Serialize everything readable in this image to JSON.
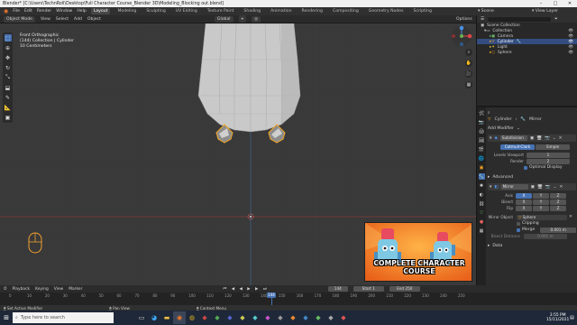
{
  "window": {
    "title": "Blender* [C:\\Users\\TechnRoll\\Desktop\\Full Character Course_Blender 3D\\Modeling_Blocking out.blend]"
  },
  "menus": [
    "File",
    "Edit",
    "Render",
    "Window",
    "Help"
  ],
  "workspaces": [
    "Layout",
    "Modeling",
    "Sculpting",
    "UV Editing",
    "Texture Paint",
    "Shading",
    "Animation",
    "Rendering",
    "Compositing",
    "Geometry Nodes",
    "Scripting"
  ],
  "top_right": {
    "scene": "Scene",
    "view_layer": "View Layer"
  },
  "viewport_header": {
    "mode": "Object Mode",
    "menus": [
      "View",
      "Select",
      "Add",
      "Object"
    ],
    "orientation": "Global",
    "options": "Options"
  },
  "view_info": {
    "line1": "Front Orthographic",
    "line2": "(144) Collection | Cylinder",
    "line3": "10 Centimeters"
  },
  "outliner": {
    "root": "Scene Collection",
    "items": [
      {
        "label": "Collection",
        "selected": false
      },
      {
        "label": "Camera",
        "selected": false
      },
      {
        "label": "Cylinder",
        "selected": true
      },
      {
        "label": "Light",
        "selected": false
      },
      {
        "label": "Sphere",
        "selected": false
      }
    ]
  },
  "properties": {
    "object": "Cylinder",
    "modifier_tab": "Mirror",
    "add_modifier": "Add Modifier",
    "subdivision": {
      "name": "Subdivision",
      "tab_active": "Catmull-Clark",
      "tab_other": "Simple",
      "levels_viewport_label": "Levels Viewport",
      "levels_viewport": "1",
      "render_label": "Render",
      "render": "2",
      "optimal_display": "Optimal Display",
      "advanced": "Advanced"
    },
    "mirror": {
      "name": "Mirror",
      "axis_label": "Axis",
      "bisect_label": "Bisect",
      "flip_label": "Flip",
      "axes": [
        "X",
        "Y",
        "Z"
      ],
      "mirror_object_label": "Mirror Object",
      "mirror_object": "Sphere",
      "clipping": "Clipping",
      "merge": "Merge",
      "merge_value": "0.001 m",
      "bisect_distance_label": "Bisect Distance",
      "bisect_distance": "0.001 m",
      "data": "Data"
    }
  },
  "timeline": {
    "menus": [
      "Playback",
      "Keying",
      "View",
      "Marker"
    ],
    "current_frame": "144",
    "start_label": "Start",
    "start": "1",
    "end_label": "End",
    "end": "250",
    "ticks": [
      "0",
      "10",
      "20",
      "30",
      "40",
      "50",
      "60",
      "70",
      "80",
      "90",
      "100",
      "110",
      "120",
      "130",
      "140",
      "150",
      "160",
      "170",
      "180",
      "190",
      "200",
      "210",
      "220",
      "230",
      "240",
      "250"
    ]
  },
  "statusbar": {
    "left": "Set Active Modifier",
    "mid": "Pan View",
    "right": "Context Menu"
  },
  "thumbnail": {
    "caption": "COMPLETE CHARACTER COURSE"
  },
  "taskbar": {
    "search_placeholder": "Type here to search",
    "time": "3:55 PM",
    "date": "15/11/2021"
  },
  "colors": {
    "accent": "#4772b3",
    "selection": "#f5a623",
    "bg": "#393939"
  }
}
